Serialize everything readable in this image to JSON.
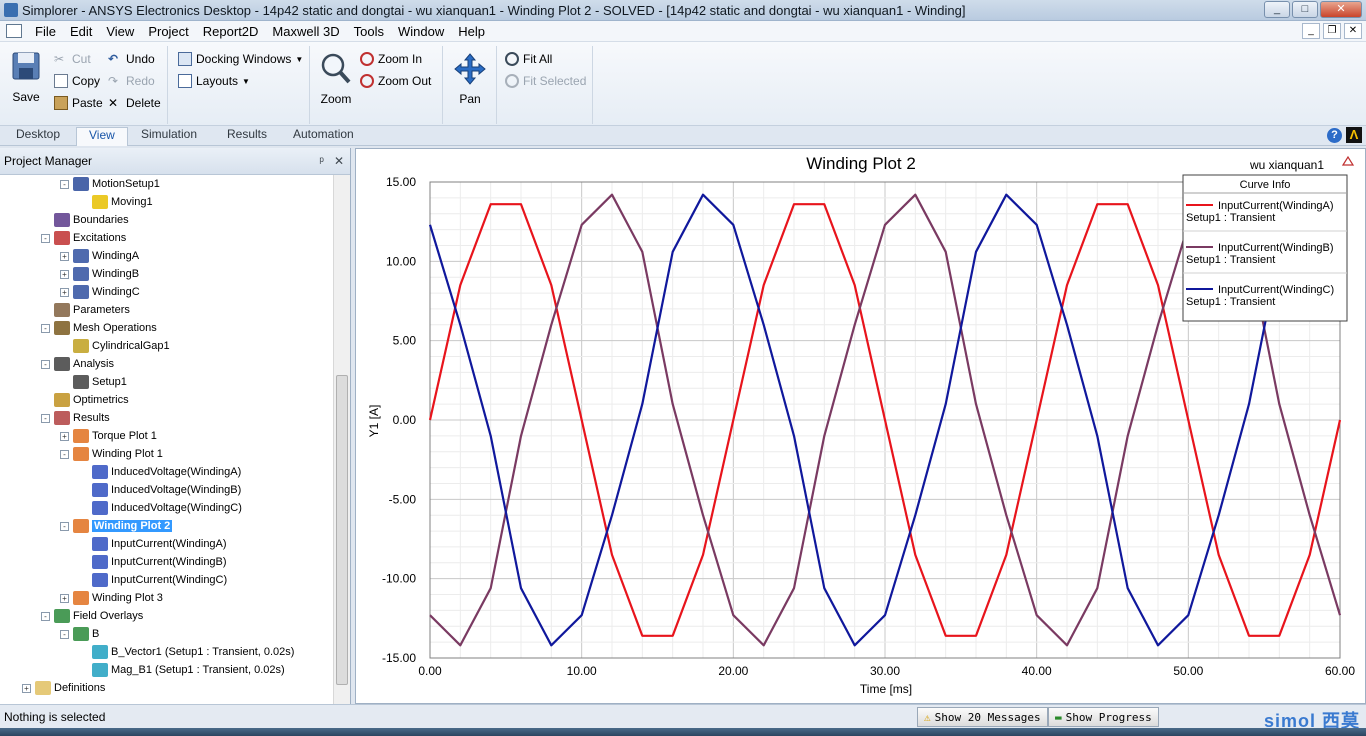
{
  "window": {
    "title": "Simplorer - ANSYS Electronics Desktop - 14p42 static and dongtai - wu xianquan1 - Winding Plot 2 - SOLVED - [14p42 static and dongtai - wu xianquan1 - Winding]",
    "minimize": "_",
    "maximize": "□",
    "close": "✕"
  },
  "menu": {
    "items": [
      "File",
      "Edit",
      "View",
      "Project",
      "Report2D",
      "Maxwell 3D",
      "Tools",
      "Window",
      "Help"
    ],
    "mdi": [
      "_",
      "❐",
      "✕"
    ]
  },
  "ribbon": {
    "save": "Save",
    "cut": "Cut",
    "copy": "Copy",
    "paste": "Paste",
    "undo": "Undo",
    "redo": "Redo",
    "delete": "Delete",
    "docking_windows": "Docking Windows",
    "layouts": "Layouts",
    "zoom": "Zoom",
    "zoom_in": "Zoom In",
    "zoom_out": "Zoom Out",
    "pan": "Pan",
    "fit_all": "Fit All",
    "fit_selected": "Fit Selected"
  },
  "tabs": [
    "Desktop",
    "View",
    "Simulation",
    "Results",
    "Automation"
  ],
  "active_tab": "View",
  "project_manager": {
    "title": "Project Manager",
    "pin": "ᵖ",
    "close": "✕",
    "tree": [
      {
        "label": "MotionSetup1",
        "level": 3,
        "exp": "-",
        "icon": "motion-setup-icon"
      },
      {
        "label": "Moving1",
        "level": 4,
        "exp": "",
        "icon": "moving-icon"
      },
      {
        "label": "Boundaries",
        "level": 2,
        "exp": "",
        "icon": "boundaries-icon"
      },
      {
        "label": "Excitations",
        "level": 2,
        "exp": "-",
        "icon": "excitations-icon"
      },
      {
        "label": "WindingA",
        "level": 3,
        "exp": "+",
        "icon": "winding-icon"
      },
      {
        "label": "WindingB",
        "level": 3,
        "exp": "+",
        "icon": "winding-icon"
      },
      {
        "label": "WindingC",
        "level": 3,
        "exp": "+",
        "icon": "winding-icon"
      },
      {
        "label": "Parameters",
        "level": 2,
        "exp": "",
        "icon": "parameters-icon"
      },
      {
        "label": "Mesh Operations",
        "level": 2,
        "exp": "-",
        "icon": "mesh-icon"
      },
      {
        "label": "CylindricalGap1",
        "level": 3,
        "exp": "",
        "icon": "mesh-op-icon"
      },
      {
        "label": "Analysis",
        "level": 2,
        "exp": "-",
        "icon": "analysis-icon"
      },
      {
        "label": "Setup1",
        "level": 3,
        "exp": "",
        "icon": "setup-icon"
      },
      {
        "label": "Optimetrics",
        "level": 2,
        "exp": "",
        "icon": "optimetrics-icon"
      },
      {
        "label": "Results",
        "level": 2,
        "exp": "-",
        "icon": "results-icon"
      },
      {
        "label": "Torque Plot 1",
        "level": 3,
        "exp": "+",
        "icon": "plot-icon"
      },
      {
        "label": "Winding Plot 1",
        "level": 3,
        "exp": "-",
        "icon": "plot-icon"
      },
      {
        "label": "InducedVoltage(WindingA)",
        "level": 4,
        "exp": "",
        "icon": "trace-icon"
      },
      {
        "label": "InducedVoltage(WindingB)",
        "level": 4,
        "exp": "",
        "icon": "trace-icon"
      },
      {
        "label": "InducedVoltage(WindingC)",
        "level": 4,
        "exp": "",
        "icon": "trace-icon"
      },
      {
        "label": "Winding Plot 2",
        "level": 3,
        "exp": "-",
        "icon": "plot-icon",
        "selected": true
      },
      {
        "label": "InputCurrent(WindingA)",
        "level": 4,
        "exp": "",
        "icon": "trace-icon"
      },
      {
        "label": "InputCurrent(WindingB)",
        "level": 4,
        "exp": "",
        "icon": "trace-icon"
      },
      {
        "label": "InputCurrent(WindingC)",
        "level": 4,
        "exp": "",
        "icon": "trace-icon"
      },
      {
        "label": "Winding Plot 3",
        "level": 3,
        "exp": "+",
        "icon": "plot-icon"
      },
      {
        "label": "Field Overlays",
        "level": 2,
        "exp": "-",
        "icon": "field-overlays-icon"
      },
      {
        "label": "B",
        "level": 3,
        "exp": "-",
        "icon": "field-folder-icon"
      },
      {
        "label": "B_Vector1 (Setup1 : Transient, 0.02s)",
        "level": 4,
        "exp": "",
        "icon": "field-plot-icon"
      },
      {
        "label": "Mag_B1 (Setup1 : Transient, 0.02s)",
        "level": 4,
        "exp": "",
        "icon": "field-plot-icon"
      },
      {
        "label": "Definitions",
        "level": 1,
        "exp": "+",
        "icon": "folder-icon"
      }
    ]
  },
  "status": {
    "text": "Nothing is selected",
    "messages": "Show 20 Messages",
    "progress": "Show Progress",
    "watermark": "simol 西莫"
  },
  "chart_data": {
    "type": "line",
    "title": "Winding Plot 2",
    "author": "wu xianquan1",
    "xlabel": "Time [ms]",
    "ylabel": "Y1 [A]",
    "xlim": [
      0,
      60
    ],
    "ylim": [
      -15,
      15
    ],
    "xticks": [
      "0.00",
      "10.00",
      "20.00",
      "30.00",
      "40.00",
      "50.00",
      "60.00"
    ],
    "yticks": [
      "15.00",
      "10.00",
      "5.00",
      "0.00",
      "-5.00",
      "-10.00",
      "-15.00"
    ],
    "grid": true,
    "legend": {
      "title": "Curve Info",
      "placement": "top-right",
      "setup": "Setup1 : Transient"
    },
    "series": [
      {
        "name": "InputCurrent(WindingA)",
        "color": "#e8141c",
        "x": [
          0,
          2,
          4,
          6,
          8,
          10,
          12,
          14,
          16,
          18,
          20,
          22,
          24,
          26,
          28,
          30,
          32,
          34,
          36,
          38,
          40,
          42,
          44,
          46,
          48,
          50,
          52,
          54,
          56,
          58,
          60
        ],
        "y": [
          0,
          8.5,
          13.6,
          13.6,
          8.5,
          0,
          -8.5,
          -13.6,
          -13.6,
          -8.5,
          0,
          8.5,
          13.6,
          13.6,
          8.5,
          0,
          -8.5,
          -13.6,
          -13.6,
          -8.5,
          0,
          8.5,
          13.6,
          13.6,
          8.5,
          0,
          -8.5,
          -13.6,
          -13.6,
          -8.5,
          0
        ]
      },
      {
        "name": "InputCurrent(WindingB)",
        "color": "#7a3a62",
        "x": [
          0,
          2,
          4,
          6,
          8,
          10,
          12,
          14,
          16,
          18,
          20,
          22,
          24,
          26,
          28,
          30,
          32,
          34,
          36,
          38,
          40,
          42,
          44,
          46,
          48,
          50,
          52,
          54,
          56,
          58,
          60
        ],
        "y": [
          -12.3,
          -14.2,
          -10.6,
          -1.0,
          6.0,
          12.3,
          14.2,
          10.6,
          1.0,
          -6.0,
          -12.3,
          -14.2,
          -10.6,
          -1.0,
          6.0,
          12.3,
          14.2,
          10.6,
          1.0,
          -6.0,
          -12.3,
          -14.2,
          -10.6,
          -1.0,
          6.0,
          12.3,
          14.2,
          10.6,
          1.0,
          -6.0,
          -12.3
        ]
      },
      {
        "name": "InputCurrent(WindingC)",
        "color": "#10189c",
        "x": [
          0,
          2,
          4,
          6,
          8,
          10,
          12,
          14,
          16,
          18,
          20,
          22,
          24,
          26,
          28,
          30,
          32,
          34,
          36,
          38,
          40,
          42,
          44,
          46,
          48,
          50,
          52,
          54,
          56,
          58,
          60
        ],
        "y": [
          12.3,
          6.0,
          -1.0,
          -10.6,
          -14.2,
          -12.3,
          -6.0,
          1.0,
          10.6,
          14.2,
          12.3,
          6.0,
          -1.0,
          -10.6,
          -14.2,
          -12.3,
          -6.0,
          1.0,
          10.6,
          14.2,
          12.3,
          6.0,
          -1.0,
          -10.6,
          -14.2,
          -12.3,
          -6.0,
          1.0,
          10.6,
          14.2,
          12.3
        ]
      }
    ]
  }
}
